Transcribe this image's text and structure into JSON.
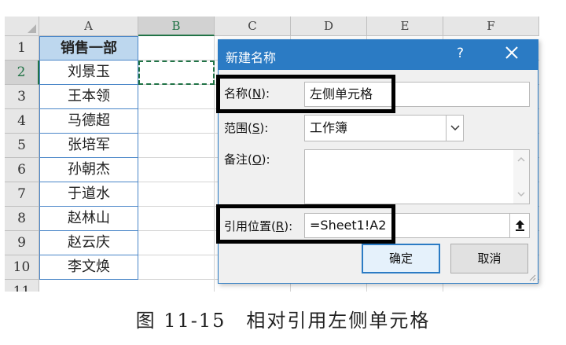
{
  "sheet": {
    "columns": [
      "A",
      "B",
      "C",
      "D",
      "E",
      "F"
    ],
    "active_column": "B",
    "rows": [
      "1",
      "2",
      "3",
      "4",
      "5",
      "6",
      "7",
      "8",
      "9",
      "10",
      "11"
    ],
    "active_row": "2",
    "a_header": "销售一部",
    "a_values": [
      "刘景玉",
      "王本领",
      "马德超",
      "张培军",
      "孙朝杰",
      "于道水",
      "赵林山",
      "赵云庆",
      "李文焕"
    ]
  },
  "dialog": {
    "title": "新建名称",
    "help": "?",
    "name_label_pre": "名称(",
    "name_label_key": "N",
    "name_label_post": "):",
    "name_value": "左侧单元格",
    "scope_label_pre": "范围(",
    "scope_label_key": "S",
    "scope_label_post": "):",
    "scope_value": "工作簿",
    "comment_label_pre": "备注(",
    "comment_label_key": "O",
    "comment_label_post": "):",
    "comment_value": "",
    "ref_label_pre": "引用位置(",
    "ref_label_key": "R",
    "ref_label_post": "):",
    "ref_value": "=Sheet1!A2",
    "ok_label": "确定",
    "cancel_label": "取消"
  },
  "caption": "图 11-15　相对引用左侧单元格",
  "colors": {
    "accent_blue": "#2b7bc4",
    "excel_green": "#217346",
    "header_fill": "#bdd7ee"
  }
}
